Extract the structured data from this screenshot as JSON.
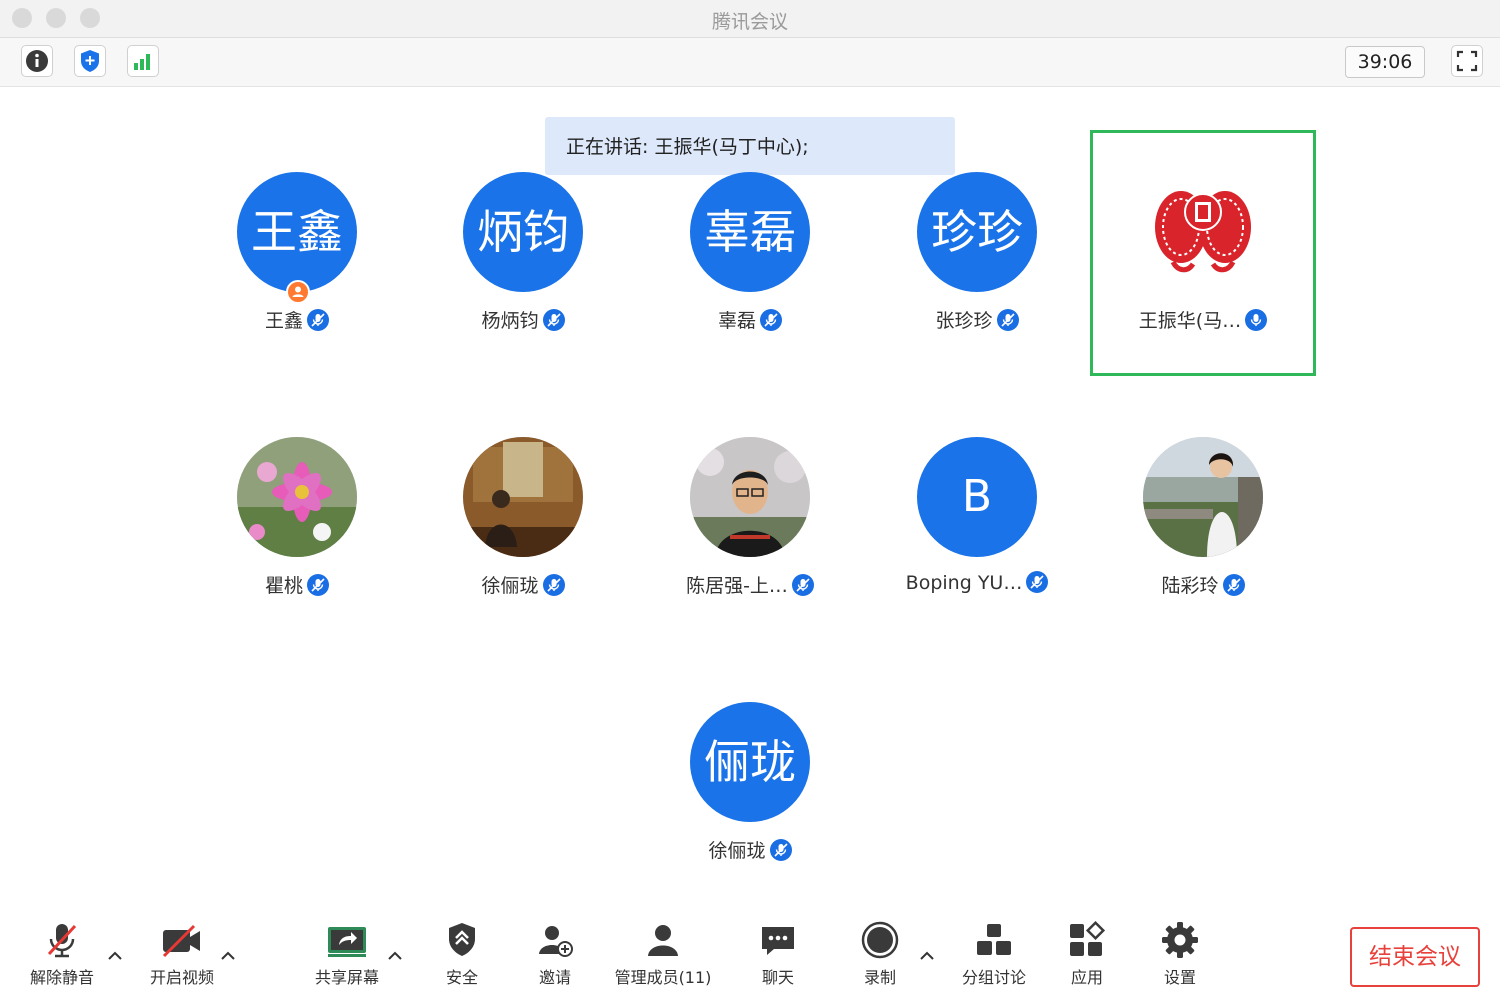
{
  "window": {
    "title": "腾讯会议"
  },
  "toolbar": {
    "timer": "39:06"
  },
  "banner": {
    "text": "正在讲话: 王振华(马丁中心);"
  },
  "participants": [
    {
      "avatar_text": "王鑫",
      "name": "王鑫",
      "host": true
    },
    {
      "avatar_text": "炳钧",
      "name": "杨炳钧"
    },
    {
      "avatar_text": "辜磊",
      "name": "辜磊"
    },
    {
      "avatar_text": "珍珍",
      "name": "张珍珍"
    },
    {
      "avatar_text": "",
      "name": "王振华(马…",
      "active": true
    },
    {
      "avatar_text": "",
      "name": "瞿桃"
    },
    {
      "avatar_text": "",
      "name": "徐俪珑"
    },
    {
      "avatar_text": "",
      "name": "陈居强-上…"
    },
    {
      "avatar_text": "B",
      "name": "Boping YU…"
    },
    {
      "avatar_text": "",
      "name": "陆彩玲"
    },
    {
      "avatar_text": "俪珑",
      "name": "徐俪珑"
    }
  ],
  "bottom": {
    "unmute": "解除静音",
    "video": "开启视频",
    "share": "共享屏幕",
    "security": "安全",
    "invite": "邀请",
    "members": "管理成员(11)",
    "chat": "聊天",
    "record": "录制",
    "breakout": "分组讨论",
    "apps": "应用",
    "settings": "设置",
    "end": "结束会议"
  },
  "colors": {
    "accent": "#1a73e8",
    "active_border": "#2fb85a",
    "end": "#e8403a",
    "host_badge": "#ff7a30"
  }
}
